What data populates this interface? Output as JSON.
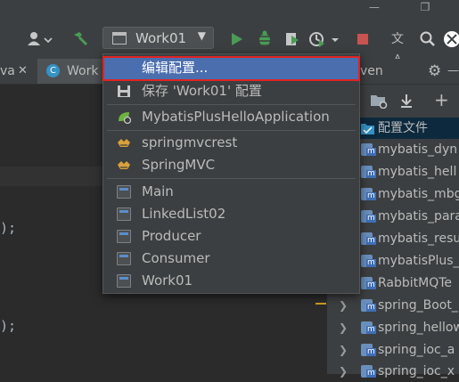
{
  "toolbar": {
    "run_config_label": "Work01",
    "icons": [
      "user-icon",
      "build-hammer-icon",
      "run-icon",
      "debug-icon",
      "coverage-icon",
      "profile-icon",
      "stop-icon",
      "translate-icon",
      "search-icon",
      "ide-logo-icon"
    ]
  },
  "tabs": {
    "left_partial": "va",
    "active": "Work",
    "right_partial": "ven"
  },
  "code": {
    "line1": ");",
    "line2": ");"
  },
  "dropdown": {
    "edit_config": "编辑配置...",
    "save_config": "保存 'Work01' 配置",
    "spring_boot_app": "MybatisPlusHelloApplication",
    "tomcat_items": [
      "springmvcrest",
      "SpringMVC"
    ],
    "app_items": [
      "Main",
      "LinkedList02",
      "Producer",
      "Consumer",
      "Work01"
    ]
  },
  "project_panel": {
    "selected_item": "配置文件",
    "modules": [
      "mybatis_dyn",
      "mybatis_hell",
      "mybatis_mbg",
      "mybatis_para",
      "mybatis_resu",
      "mybatisPlus_",
      "RabbitMQTe",
      "spring_Boot_",
      "spring_hellow",
      "spring_ioc_a",
      "spring_ioc_x"
    ]
  },
  "colors": {
    "selection": "#4b6eaf",
    "highlight_border": "#e02323",
    "run_green": "#499c54",
    "stop_red": "#c75450",
    "folder_blue": "#3592c4"
  }
}
